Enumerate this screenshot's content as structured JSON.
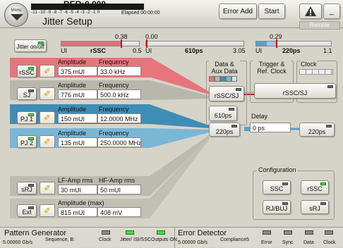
{
  "header": {
    "menu_label": "Menu",
    "ber_label": "BER:",
    "ber_value": "0.000",
    "log_scale": "-11 -10 -9 -8 -7 -6 -5 -4 -3 -2 -1  0",
    "elapsed_label": "Elapsed 00:00:00",
    "title": "Jitter Setup",
    "error_add": "Error Add",
    "start": "Start",
    "remote": "Remote",
    "minimize": "_"
  },
  "meters": {
    "rssc": {
      "top": "0.38",
      "left": "UI",
      "name": "rSSC",
      "right": "0.5",
      "fill_fraction": 0.76
    },
    "total": {
      "top": "0.00",
      "left": "UI",
      "name": "610ps",
      "right": "3.05",
      "fill_fraction": 0.0
    },
    "right": {
      "top": "0.29",
      "left": "UI",
      "name": "220ps",
      "right": "1.1",
      "fill_fraction": 0.26
    }
  },
  "jitter_onoff": "Jitter on/off",
  "rows": [
    {
      "btn": "rSSC",
      "h1": "Amplitude",
      "h2": "Frequency",
      "v1": "375 mUI",
      "v2": "33.0 kHz",
      "color": "#e8747c"
    },
    {
      "btn": "SJ",
      "h1": "Amplitude",
      "h2": "Frequency",
      "v1": "776 mUI",
      "v2": "500.0 kHz",
      "color": "#b8b5aa"
    },
    {
      "btn": "PJ 1",
      "h1": "Amplitude",
      "h2": "Frequency",
      "v1": "150 mUI",
      "v2": "12.0000 MHz",
      "color": "#3f8fb8"
    },
    {
      "btn": "PJ 2",
      "h1": "Amplitude",
      "h2": "Frequency",
      "v1": "135 mUI",
      "v2": "250.0000 MHz",
      "color": "#7ab7d6"
    }
  ],
  "srj": {
    "btn": "sRJ",
    "h1": "LF-Amp rms",
    "h2": "HF-Amp rms",
    "v1": "30 mUI",
    "v2": "50 mUI"
  },
  "ext": {
    "btn": "Ext",
    "h1": "Amplitude (max)",
    "v1": "815 mUI",
    "v2": "408 mV"
  },
  "groups": {
    "data_aux": "Data & Aux Data",
    "trigger": "Trigger & Ref. Clock",
    "clock": "Clock",
    "delay": "Delay",
    "configuration": "Configuration"
  },
  "routing": {
    "rssc_sj_a": "rSSC/SJ",
    "rssc_sj_b": "rSSC/SJ",
    "b610": "610ps",
    "b220a": "220ps",
    "delay_value": "0 ps",
    "b220b": "220ps"
  },
  "config": {
    "ssc": "SSC",
    "rssc": "rSSC",
    "rjbuj": "RJ/BUJ",
    "srj": "sRJ"
  },
  "status": {
    "pg_title": "Pattern Generator",
    "pg_rate": "5.00000 Gb/s",
    "pg_seq": "Sequence, B:",
    "pg_clock": "Clock",
    "pg_jitter": "Jitter/ ISI/SSC",
    "pg_outputs": "Outputs ON",
    "ed_title": "Error Detector",
    "ed_rate": "5.00000 Gb/s",
    "ed_comp": "Compliance5",
    "ed_error": "Error",
    "ed_sync": "Sync",
    "ed_data": "Data",
    "ed_clock": "Clock"
  }
}
